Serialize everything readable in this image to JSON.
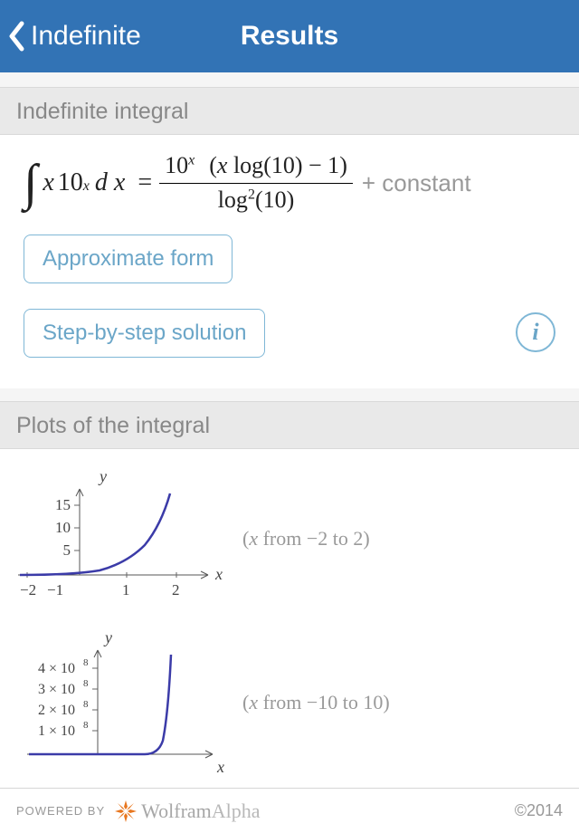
{
  "header": {
    "back_label": "Indefinite",
    "title": "Results"
  },
  "sections": {
    "integral_title": "Indefinite integral",
    "plots_title": "Plots of the integral"
  },
  "equation": {
    "integrand_base": "x",
    "integrand_pow_base": "10",
    "integrand_pow_exp": "x",
    "dx": "d x",
    "equals": "=",
    "num_pow_base": "10",
    "num_pow_exp": "x",
    "num_paren_open": "(",
    "num_x": "x",
    "num_log": " log",
    "num_log_arg": "(10)",
    "num_minus_one": " − 1",
    "num_paren_close": ")",
    "den_log": "log",
    "den_sup": "2",
    "den_arg": "(10)",
    "constant": "+ constant"
  },
  "buttons": {
    "approximate": "Approximate form",
    "step_by_step": "Step-by-step solution",
    "info": "i"
  },
  "plots": {
    "caption1_prefix": "(",
    "caption1_var": "x",
    "caption1_text": " from −2 to 2)",
    "caption2_prefix": "(",
    "caption2_var": "x",
    "caption2_text": " from −10 to 10)",
    "plot1": {
      "y_label": "y",
      "x_label": "x",
      "y_ticks": [
        "5",
        "10",
        "15"
      ],
      "x_ticks": [
        "−2",
        "−1",
        "1",
        "2"
      ]
    },
    "plot2": {
      "y_label": "y",
      "x_label": "x",
      "y_ticks": [
        "1 × 10",
        "2 × 10",
        "3 × 10",
        "4 × 10"
      ],
      "y_ticks_exp": "8"
    }
  },
  "footer": {
    "powered_by": "POWERED BY",
    "brand1": "Wolfram",
    "brand2": "Alpha",
    "copyright": "©2014"
  }
}
